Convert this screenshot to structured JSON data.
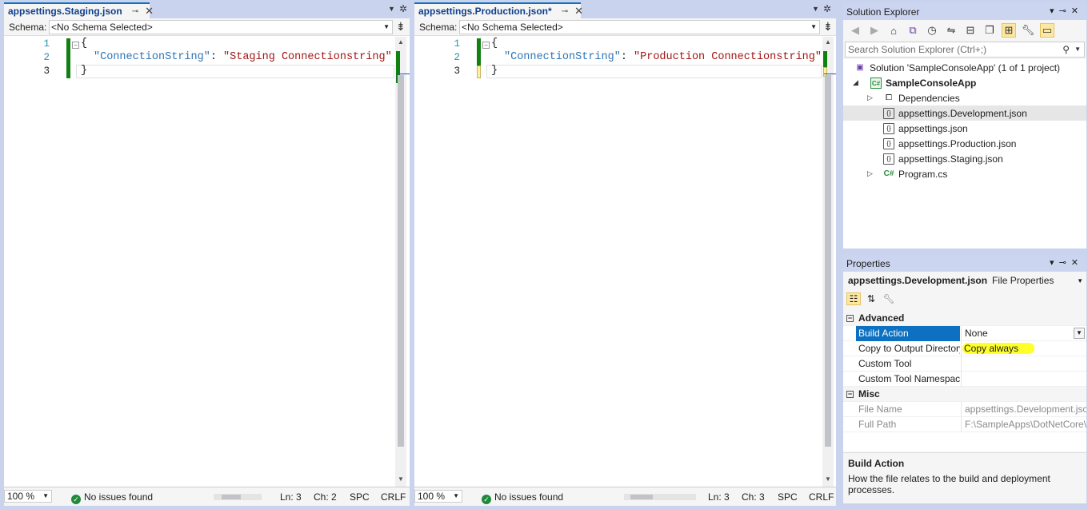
{
  "left_editor": {
    "tab_title": "appsettings.Staging.json",
    "schema_label": "Schema:",
    "schema_value": "<No Schema Selected>",
    "lines": [
      "1",
      "2",
      "3"
    ],
    "code": {
      "open": "{",
      "key": "\"ConnectionString\"",
      "colon": ": ",
      "value": "\"Staging Connectionstring\"",
      "close": "}"
    },
    "status": {
      "zoom": "100 %",
      "issues": "No issues found",
      "ln": "Ln: 3",
      "ch": "Ch: 2",
      "spc": "SPC",
      "eol": "CRLF"
    }
  },
  "right_editor": {
    "tab_title": "appsettings.Production.json*",
    "schema_label": "Schema:",
    "schema_value": "<No Schema Selected>",
    "lines": [
      "1",
      "2",
      "3"
    ],
    "code": {
      "open": "{",
      "key": "\"ConnectionString\"",
      "colon": ": ",
      "value": "\"Production Connectionstring\"",
      "close": "}"
    },
    "status": {
      "zoom": "100 %",
      "issues": "No issues found",
      "ln": "Ln: 3",
      "ch": "Ch: 3",
      "spc": "SPC",
      "eol": "CRLF"
    }
  },
  "solution_explorer": {
    "title": "Solution Explorer",
    "search_placeholder": "Search Solution Explorer (Ctrl+;)",
    "items": [
      {
        "label": "Solution 'SampleConsoleApp' (1 of 1 project)",
        "icon": "solution-icon"
      },
      {
        "label": "SampleConsoleApp",
        "icon": "csharp-project-icon"
      },
      {
        "label": "Dependencies",
        "icon": "dependencies-icon"
      },
      {
        "label": "appsettings.Development.json",
        "icon": "json-file-icon"
      },
      {
        "label": "appsettings.json",
        "icon": "json-file-icon"
      },
      {
        "label": "appsettings.Production.json",
        "icon": "json-file-icon"
      },
      {
        "label": "appsettings.Staging.json",
        "icon": "json-file-icon"
      },
      {
        "label": "Program.cs",
        "icon": "csharp-file-icon"
      }
    ]
  },
  "properties": {
    "title": "Properties",
    "object_name": "appsettings.Development.json",
    "object_type": "File Properties",
    "categories": [
      {
        "name": "Advanced",
        "rows": [
          {
            "name": "Build Action",
            "value": "None"
          },
          {
            "name": "Copy to Output Directory",
            "value": "Copy always"
          },
          {
            "name": "Custom Tool",
            "value": ""
          },
          {
            "name": "Custom Tool Namespace",
            "value": ""
          }
        ]
      },
      {
        "name": "Misc",
        "rows": [
          {
            "name": "File Name",
            "value": "appsettings.Development.json"
          },
          {
            "name": "Full Path",
            "value": "F:\\SampleApps\\DotNetCore\\"
          }
        ]
      }
    ],
    "description_title": "Build Action",
    "description_text": "How the file relates to the build and deployment processes."
  },
  "colors": {
    "accent": "#0e70c0",
    "change_bar": "#108010",
    "highlight": "#ffff2a",
    "title_bar": "#ccd5f0"
  }
}
